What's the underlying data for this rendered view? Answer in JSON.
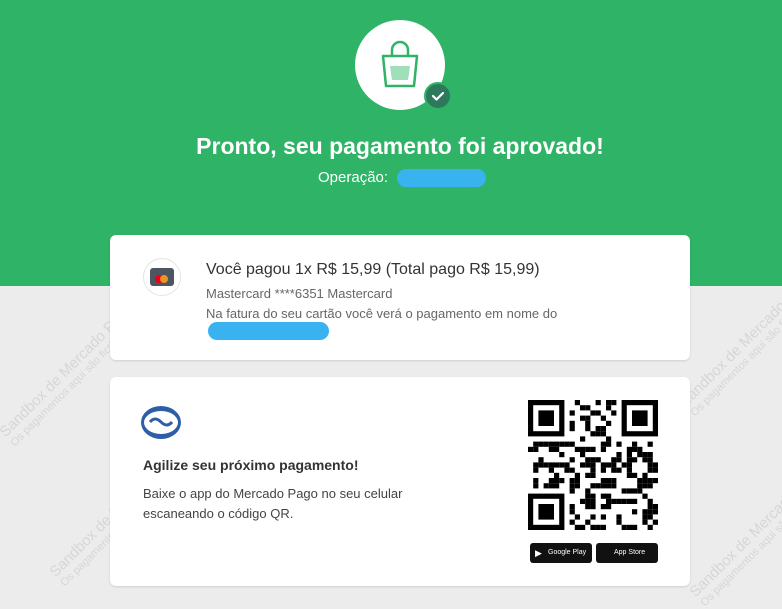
{
  "header": {
    "title": "Pronto, seu pagamento foi aprovado!",
    "operation_label": "Operação:"
  },
  "payment": {
    "summary": "Você pagou 1x R$ 15,99 (Total pago R$ 15,99)",
    "card": "Mastercard ****6351 Mastercard",
    "statement_note": "Na fatura do seu cartão você verá o pagamento em nome do"
  },
  "promo": {
    "title": "Agilize seu próximo pagamento!",
    "line1": "Baixe o app do Mercado Pago no seu celular",
    "line2": "escaneando o código QR.",
    "google_play": "Google Play",
    "app_store": "App Store"
  },
  "watermark": {
    "text": "Sandbox de Mercado Pago",
    "subtext": "Os pagamentos aqui são fictícios"
  },
  "colors": {
    "brand_green": "#2fb366",
    "check_green": "#2c7a5b",
    "redaction_blue": "#39b2f0"
  },
  "icons": [
    "shopping-bag-icon",
    "check-icon",
    "mastercard-icon",
    "mercado-pago-logo-icon",
    "qr-code",
    "google-play-icon",
    "apple-icon"
  ]
}
